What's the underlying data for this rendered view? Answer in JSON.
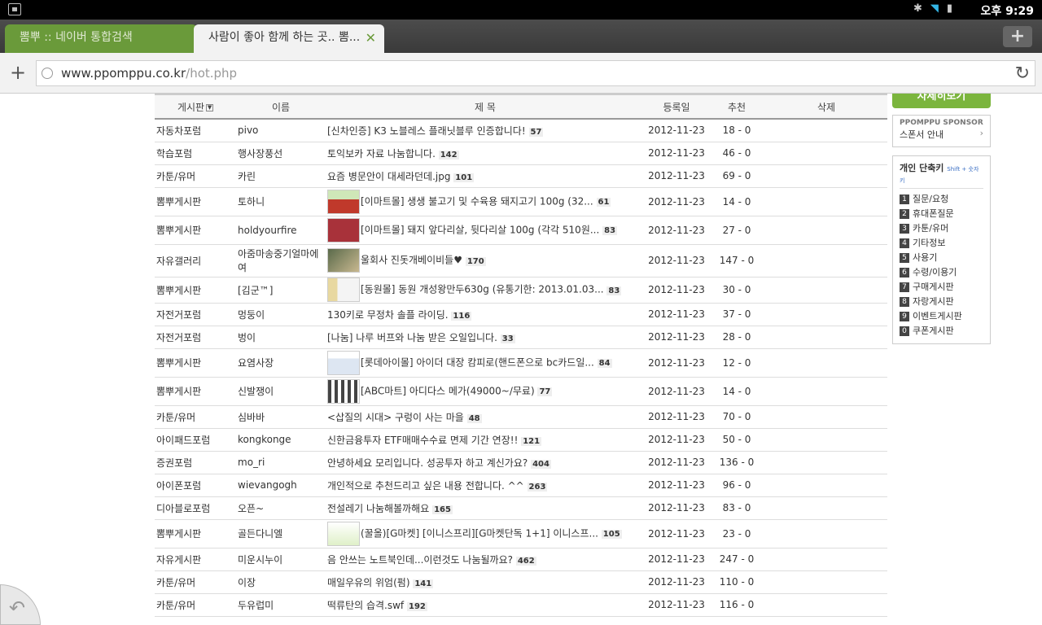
{
  "status": {
    "clock": "오후 9:29",
    "icons": [
      "notification-icon",
      "bluetooth-icon",
      "wifi-icon",
      "battery-icon"
    ]
  },
  "tabs": [
    {
      "label": "뽐뿌 :: 네이버 통합검색"
    },
    {
      "label": "사람이 좋아 함께 하는 곳.. 뽐...",
      "close": "✕"
    }
  ],
  "urlbar": {
    "domain": "www.ppomppu.co.kr",
    "path": "/hot.php"
  },
  "table": {
    "headers": {
      "board": "게시판",
      "name": "이름",
      "title": "제 목",
      "date": "등록일",
      "rec": "추천",
      "del": "삭제"
    },
    "rows": [
      {
        "board": "자동차포럼",
        "name": "pivo",
        "title": "[신차인증] K3 노블레스 플래닛블루 인증합니다!",
        "count": "57",
        "date": "2012-11-23",
        "rec": "18 - 0",
        "thumb": ""
      },
      {
        "board": "학습포럼",
        "name": "행사장풍선",
        "title": "토익보카 자료 나눔합니다.",
        "count": "142",
        "date": "2012-11-23",
        "rec": "46 - 0",
        "thumb": ""
      },
      {
        "board": "카툰/유머",
        "name": "카린",
        "title": "요즘 병문안이 대세라던데.jpg",
        "count": "101",
        "date": "2012-11-23",
        "rec": "69 - 0",
        "thumb": ""
      },
      {
        "board": "뽐뿌게시판",
        "name": "토하니",
        "title": "[이마트몰] 생생 불고기 및 수육용 돼지고기 100g (32...",
        "count": "61",
        "date": "2012-11-23",
        "rec": "14 - 0",
        "thumb": "t1"
      },
      {
        "board": "뽐뿌게시판",
        "name": "holdyourfire",
        "title": "[이마트몰] 돼지 앞다리살, 뒷다리살 100g (각각 510원...",
        "count": "83",
        "date": "2012-11-23",
        "rec": "27 - 0",
        "thumb": "t2"
      },
      {
        "board": "자유갤러리",
        "name": "아줌마송중기얼마에여",
        "title": "울회사 진돗개베이비들♥",
        "count": "170",
        "date": "2012-11-23",
        "rec": "147 - 0",
        "thumb": "t3"
      },
      {
        "board": "뽐뿌게시판",
        "name": "[김군™]",
        "title": "[동원몰] 동원 개성왕만두630g (유통기한: 2013.01.03...",
        "count": "83",
        "date": "2012-11-23",
        "rec": "30 - 0",
        "thumb": "t4"
      },
      {
        "board": "자전거포럼",
        "name": "멍둥이",
        "title": "130키로 무정차 솔플 라이딩.",
        "count": "116",
        "date": "2012-11-23",
        "rec": "37 - 0",
        "thumb": ""
      },
      {
        "board": "자전거포럼",
        "name": "벙이",
        "title": "[나눔] 나루 버프와 나눔 받은 오일입니다.",
        "count": "33",
        "date": "2012-11-23",
        "rec": "28 - 0",
        "thumb": ""
      },
      {
        "board": "뽐뿌게시판",
        "name": "요염사장",
        "title": "[롯데아이몰] 아이더 대장 캄피로(핸드폰으로 bc카드일...",
        "count": "84",
        "date": "2012-11-23",
        "rec": "12 - 0",
        "thumb": "t5"
      },
      {
        "board": "뽐뿌게시판",
        "name": "신발쟁이",
        "title": "[ABC마트] 아디다스 메가(49000~/무료)",
        "count": "77",
        "date": "2012-11-23",
        "rec": "14 - 0",
        "thumb": "t6"
      },
      {
        "board": "카툰/유머",
        "name": "심바바",
        "title": "<삽질의 시대> 구렁이 사는 마을",
        "count": "48",
        "date": "2012-11-23",
        "rec": "70 - 0",
        "thumb": ""
      },
      {
        "board": "아이패드포럼",
        "name": "kongkonge",
        "title": "신한금융투자 ETF매매수수료 면제 기간 연장!!",
        "count": "121",
        "date": "2012-11-23",
        "rec": "50 - 0",
        "thumb": ""
      },
      {
        "board": "증권포럼",
        "name": "mo_ri",
        "title": "안녕하세요 모리입니다. 성공투자 하고 계신가요?",
        "count": "404",
        "date": "2012-11-23",
        "rec": "136 - 0",
        "thumb": ""
      },
      {
        "board": "아이폰포럼",
        "name": "wievangogh",
        "title": "개인적으로 추천드리고 싶은 내용 전합니다. ^^",
        "count": "263",
        "date": "2012-11-23",
        "rec": "96 - 0",
        "thumb": ""
      },
      {
        "board": "디아블로포럼",
        "name": "오픈~",
        "title": "전설레기 나눔해볼까해요",
        "count": "165",
        "date": "2012-11-23",
        "rec": "83 - 0",
        "thumb": ""
      },
      {
        "board": "뽐뿌게시판",
        "name": "골든다니엘",
        "title": "(꿀올)[G마켓] [이니스프리][G마켓단독 1+1] 이니스프...",
        "count": "105",
        "date": "2012-11-23",
        "rec": "23 - 0",
        "thumb": "t7"
      },
      {
        "board": "자유게시판",
        "name": "미운시누이",
        "title": "음 안쓰는 노트북인데...이런것도 나눔될까요?",
        "count": "462",
        "date": "2012-11-23",
        "rec": "247 - 0",
        "thumb": ""
      },
      {
        "board": "카툰/유머",
        "name": "이장",
        "title": "매일우유의 위엄(펌)",
        "count": "141",
        "date": "2012-11-23",
        "rec": "110 - 0",
        "thumb": ""
      },
      {
        "board": "카툰/유머",
        "name": "두유럽미",
        "title": "떡류탄의 습격.swf",
        "count": "192",
        "date": "2012-11-23",
        "rec": "116 - 0",
        "thumb": ""
      }
    ]
  },
  "sidebar": {
    "detail_button": "자세히보기",
    "sponsor_top": "PPOMPPU SPONSOR",
    "sponsor_link": "스폰서 안내",
    "shortcut_title": "개인 단축키",
    "shortcut_hint": "Shift + 숫자키",
    "shortcuts": [
      {
        "key": "1",
        "label": "질문/요청"
      },
      {
        "key": "2",
        "label": "휴대폰질문"
      },
      {
        "key": "3",
        "label": "카툰/유머"
      },
      {
        "key": "4",
        "label": "기타정보"
      },
      {
        "key": "5",
        "label": "사용기"
      },
      {
        "key": "6",
        "label": "수령/이용기"
      },
      {
        "key": "7",
        "label": "구매게시판"
      },
      {
        "key": "8",
        "label": "자랑게시판"
      },
      {
        "key": "9",
        "label": "이벤트게시판"
      },
      {
        "key": "0",
        "label": "쿠폰게시판"
      }
    ]
  }
}
